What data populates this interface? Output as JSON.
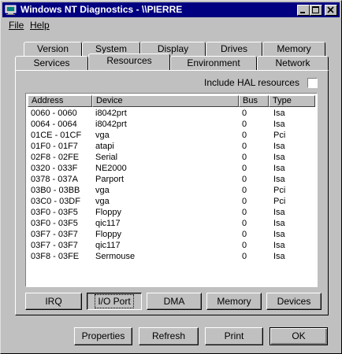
{
  "window": {
    "title": "Windows NT Diagnostics - \\\\PIERRE"
  },
  "titlebar_buttons": [
    {
      "name": "minimize",
      "icon": "minimize-icon"
    },
    {
      "name": "maximize",
      "icon": "maximize-icon"
    },
    {
      "name": "close",
      "icon": "close-icon"
    }
  ],
  "menu": {
    "file": "File",
    "help": "Help"
  },
  "tabs_back": [
    "Version",
    "System",
    "Display",
    "Drives",
    "Memory"
  ],
  "tabs_front": [
    "Services",
    "Resources",
    "Environment",
    "Network"
  ],
  "active_tab": "Resources",
  "hal": {
    "label": "Include HAL resources",
    "checked": false
  },
  "table": {
    "columns": [
      "Address",
      "Device",
      "Bus",
      "Type"
    ],
    "rows": [
      [
        "0060 - 0060",
        "i8042prt",
        "0",
        "Isa"
      ],
      [
        "0064 - 0064",
        "i8042prt",
        "0",
        "Isa"
      ],
      [
        "01CE - 01CF",
        "vga",
        "0",
        "Pci"
      ],
      [
        "01F0 - 01F7",
        "atapi",
        "0",
        "Isa"
      ],
      [
        "02F8 - 02FE",
        "Serial",
        "0",
        "Isa"
      ],
      [
        "0320 - 033F",
        "NE2000",
        "0",
        "Isa"
      ],
      [
        "0378 - 037A",
        "Parport",
        "0",
        "Isa"
      ],
      [
        "03B0 - 03BB",
        "vga",
        "0",
        "Pci"
      ],
      [
        "03C0 - 03DF",
        "vga",
        "0",
        "Pci"
      ],
      [
        "03F0 - 03F5",
        "Floppy",
        "0",
        "Isa"
      ],
      [
        "03F0 - 03F5",
        "qic117",
        "0",
        "Isa"
      ],
      [
        "03F7 - 03F7",
        "Floppy",
        "0",
        "Isa"
      ],
      [
        "03F7 - 03F7",
        "qic117",
        "0",
        "Isa"
      ],
      [
        "03F8 - 03FE",
        "Sermouse",
        "0",
        "Isa"
      ]
    ]
  },
  "resource_buttons": {
    "irq": "IRQ",
    "io_port": "I/O Port",
    "dma": "DMA",
    "memory": "Memory",
    "devices": "Devices"
  },
  "dialog_buttons": {
    "properties": "Properties",
    "refresh": "Refresh",
    "print": "Print",
    "ok": "OK"
  },
  "colors": {
    "titlebar": "#000080",
    "face": "#c0c0c0",
    "list_bg": "#ffffff"
  }
}
